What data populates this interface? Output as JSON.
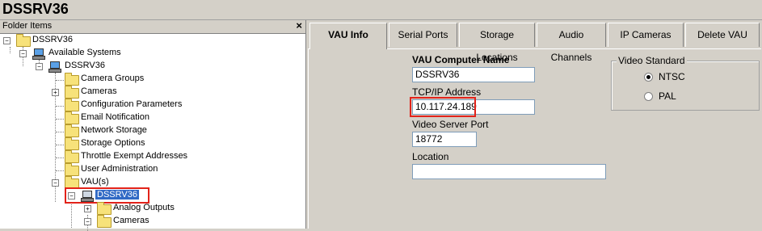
{
  "window": {
    "title": "DSSRV36"
  },
  "left_pane": {
    "header": "Folder Items",
    "close": "×",
    "tree": {
      "root": "DSSRV36",
      "available_systems": "Available Systems",
      "server": "DSSRV36",
      "items": [
        "Camera Groups",
        "Cameras",
        "Configuration Parameters",
        "Email Notification",
        "Network Storage",
        "Storage Options",
        "Throttle Exempt Addresses",
        "User Administration",
        "VAU(s)"
      ],
      "vau_node": "DSSRV36",
      "vau_children": [
        "Analog Outputs",
        "Cameras"
      ]
    }
  },
  "tabs": [
    "VAU Info",
    "Serial Ports",
    "Storage Locations",
    "Audio Channels",
    "IP Cameras",
    "Delete VAU"
  ],
  "active_tab": "VAU Info",
  "form": {
    "computer_name_label": "VAU Computer Name",
    "computer_name_value": "DSSRV36",
    "ip_label": "TCP/IP Address",
    "ip_value": "10.117.24.189",
    "port_label": "Video Server Port",
    "port_value": "18772",
    "location_label": "Location",
    "location_value": ""
  },
  "video_standard": {
    "label": "Video Standard",
    "options": [
      "NTSC",
      "PAL"
    ],
    "selected": "NTSC"
  },
  "colors": {
    "highlight": "#e2231a",
    "selection": "#316ac5"
  }
}
